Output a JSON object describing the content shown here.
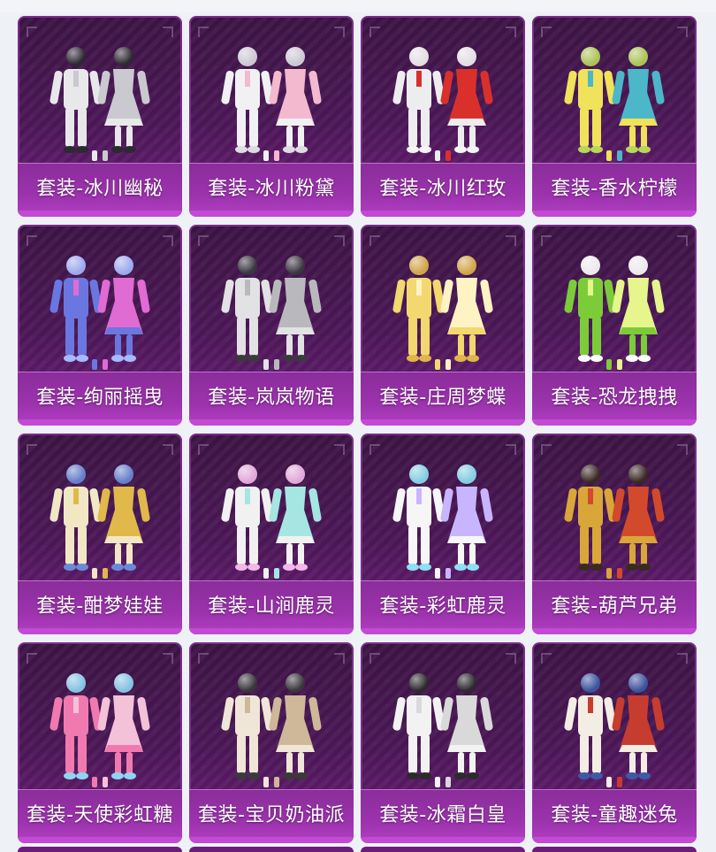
{
  "items": [
    {
      "label": "套装-冰川幽秘",
      "palette": [
        "#e8e8ea",
        "#c9c9cf",
        "#2a2a30"
      ]
    },
    {
      "label": "套装-冰川粉黛",
      "palette": [
        "#f1f1f4",
        "#f2b9cf",
        "#dcdce2"
      ]
    },
    {
      "label": "套装-冰川红玫",
      "palette": [
        "#ededf0",
        "#d9302c",
        "#f4f4f4"
      ]
    },
    {
      "label": "套装-香水柠檬",
      "palette": [
        "#f0e25a",
        "#4bb7c9",
        "#b7d65a"
      ]
    },
    {
      "label": "套装-绚丽摇曳",
      "palette": [
        "#6a77e0",
        "#e06bd2",
        "#a7b9ff"
      ]
    },
    {
      "label": "套装-岚岚物语",
      "palette": [
        "#e2e2e4",
        "#b9b9bd",
        "#3a3a3e"
      ]
    },
    {
      "label": "套装-庄周梦蝶",
      "palette": [
        "#f2d86e",
        "#fff3c4",
        "#e0b54a"
      ]
    },
    {
      "label": "套装-恐龙拽拽",
      "palette": [
        "#7ccc3a",
        "#e6f58c",
        "#ffffff"
      ]
    },
    {
      "label": "套装-酣梦娃娃",
      "palette": [
        "#f1e7c5",
        "#e0b94a",
        "#6a8ad8"
      ]
    },
    {
      "label": "套装-山涧鹿灵",
      "palette": [
        "#f1f1f1",
        "#a6e6e2",
        "#f2b8e8"
      ]
    },
    {
      "label": "套装-彩虹鹿灵",
      "palette": [
        "#f6f6f6",
        "#c8b5ff",
        "#8de0f2"
      ]
    },
    {
      "label": "套装-葫芦兄弟",
      "palette": [
        "#d9a63a",
        "#d24a2b",
        "#3a2a20"
      ]
    },
    {
      "label": "套装-天使彩虹糖",
      "palette": [
        "#f07ab0",
        "#f4c2d8",
        "#8fd5f2"
      ]
    },
    {
      "label": "套装-宝贝奶油派",
      "palette": [
        "#f0e6d8",
        "#cfb79a",
        "#3a3a3a"
      ]
    },
    {
      "label": "套装-冰霜白皇",
      "palette": [
        "#f2f2f2",
        "#d9d9d9",
        "#2b2b2b"
      ]
    },
    {
      "label": "套装-童趣迷兔",
      "palette": [
        "#f3ede4",
        "#c63c2f",
        "#3c5aa6"
      ]
    }
  ]
}
